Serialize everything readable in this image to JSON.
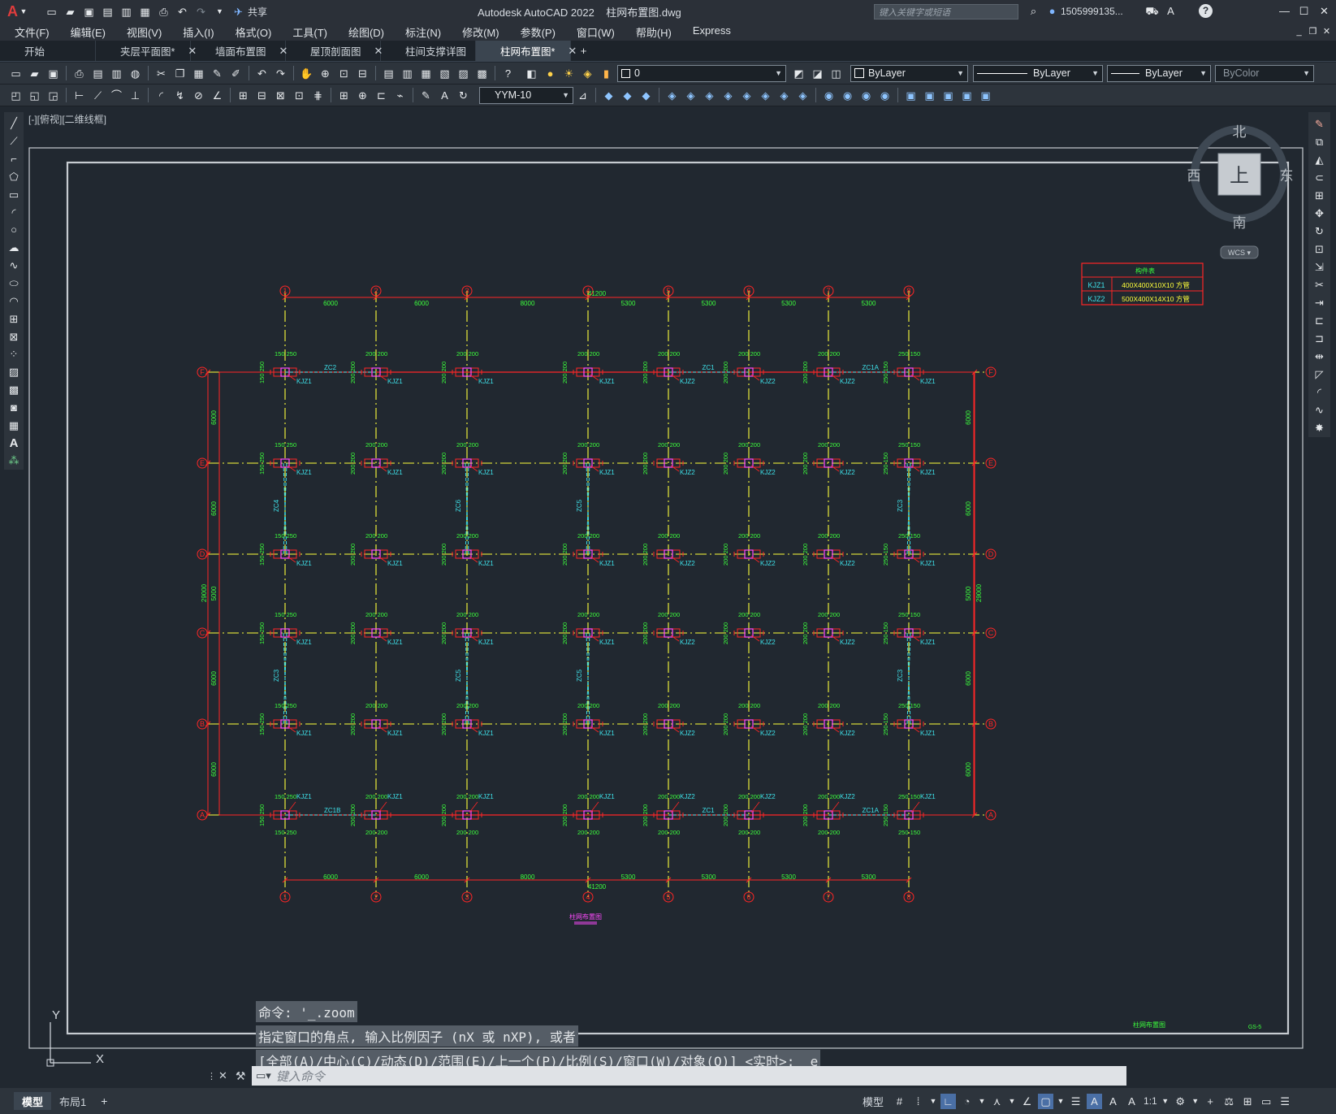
{
  "app": {
    "logo": "A",
    "share": "共享",
    "title": "Autodesk AutoCAD 2022",
    "filename": "柱网布置图.dwg",
    "search_placeholder": "键入关键字或短语",
    "user": "1505999135...",
    "help": "?"
  },
  "menu": [
    "文件(F)",
    "编辑(E)",
    "视图(V)",
    "插入(I)",
    "格式(O)",
    "工具(T)",
    "绘图(D)",
    "标注(N)",
    "修改(M)",
    "参数(P)",
    "窗口(W)",
    "帮助(H)",
    "Express"
  ],
  "tabs": [
    {
      "label": "开始",
      "active": false
    },
    {
      "label": "夹层平面图*",
      "active": false
    },
    {
      "label": "墙面布置图",
      "active": false
    },
    {
      "label": "屋顶剖面图",
      "active": false
    },
    {
      "label": "柱间支撑详图",
      "active": false
    },
    {
      "label": "柱网布置图*",
      "active": true
    }
  ],
  "toolbar": {
    "layer_value": "0",
    "color": "ByLayer",
    "linetype": "ByLayer",
    "lineweight": "ByLayer",
    "plotstyle": "ByColor",
    "dimstyle": "YYM-10"
  },
  "viewport": {
    "label": "[-][俯视][二维线框]"
  },
  "viewcube": {
    "north": "北",
    "south": "南",
    "east": "东",
    "west": "西",
    "face": "上",
    "wcs": "WCS"
  },
  "drawing": {
    "col_axes": [
      "1",
      "2",
      "3",
      "4",
      "5",
      "6",
      "7",
      "8"
    ],
    "row_axes": [
      "F",
      "E",
      "D",
      "C",
      "B",
      "A"
    ],
    "bay_dims": [
      "6000",
      "6000",
      "8000",
      "5300",
      "5300",
      "5300",
      "5300"
    ],
    "total_width": "41200",
    "row_dims": [
      "6000",
      "6000",
      "5000",
      "6000",
      "6000"
    ],
    "total_height": "29000",
    "legend": {
      "header": "构件表",
      "rows": [
        [
          "KJZ1",
          "400X400X10X10 方管"
        ],
        [
          "KJZ2",
          "500X400X14X10 方管"
        ]
      ]
    },
    "title": "柱网布置图",
    "frame_title": "柱网布置图",
    "frame_no": "GS-5"
  },
  "command": {
    "history": [
      "命令: '_.zoom",
      "指定窗口的角点, 输入比例因子 (nX 或 nXP), 或者",
      "[全部(A)/中心(C)/动态(D)/范围(E)/上一个(P)/比例(S)/窗口(W)/对象(O)] <实时>: _e"
    ],
    "placeholder": "键入命令"
  },
  "status": {
    "layouts": [
      {
        "label": "模型",
        "active": true
      },
      {
        "label": "布局1",
        "active": false
      }
    ],
    "model": "模型",
    "scale": "1:1"
  },
  "ucs": {
    "x": "X",
    "y": "Y"
  }
}
